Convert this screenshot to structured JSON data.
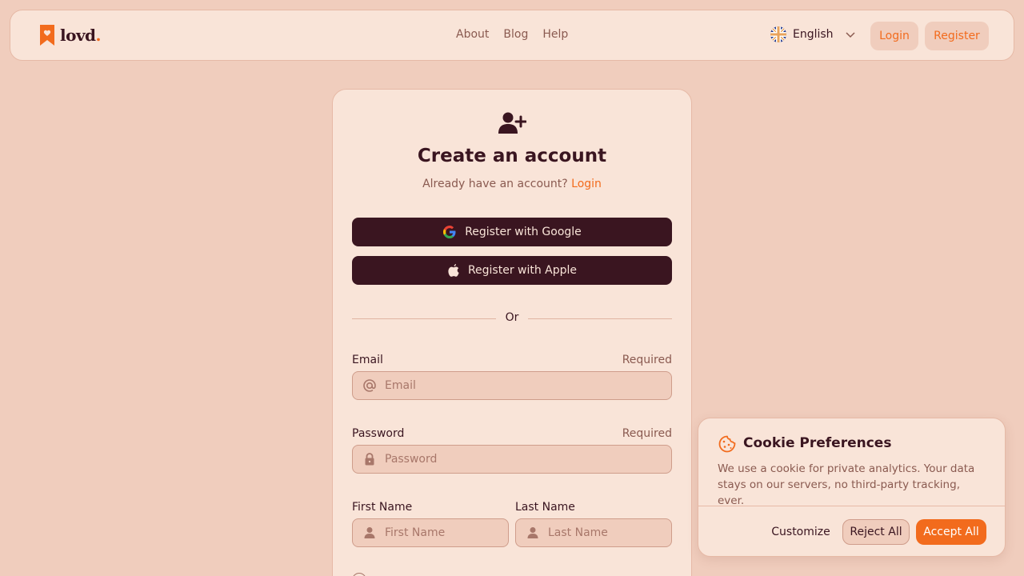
{
  "header": {
    "logo_text": "lovd",
    "logo_dot": ".",
    "nav": [
      "About",
      "Blog",
      "Help"
    ],
    "language": "English",
    "login_label": "Login",
    "register_label": "Register"
  },
  "card": {
    "title": "Create an account",
    "subtitle_text": "Already have an account?",
    "subtitle_link": "Login",
    "google_label": "Register with Google",
    "apple_label": "Register with Apple",
    "divider_text": "Or",
    "email": {
      "label": "Email",
      "required": "Required",
      "placeholder": "Email",
      "value": ""
    },
    "password": {
      "label": "Password",
      "required": "Required",
      "placeholder": "Password",
      "value": ""
    },
    "first_name": {
      "label": "First Name",
      "placeholder": "First Name",
      "value": ""
    },
    "last_name": {
      "label": "Last Name",
      "placeholder": "Last Name",
      "value": ""
    }
  },
  "cookie": {
    "title": "Cookie Preferences",
    "text": "We use a cookie for private analytics. Your data stays on our servers, no third-party tracking, ever.",
    "customize_label": "Customize",
    "reject_label": "Reject All",
    "accept_label": "Accept All"
  },
  "colors": {
    "accent": "#f26b1d",
    "dark": "#3a1520",
    "background": "#f0cdbd",
    "surface": "#f9e4d8"
  },
  "icons": [
    "logo-bookmark-heart-icon",
    "uk-flag-icon",
    "chevron-down-icon",
    "user-plus-icon",
    "google-icon",
    "apple-icon",
    "at-sign-icon",
    "lock-icon",
    "user-icon",
    "cookie-icon"
  ]
}
